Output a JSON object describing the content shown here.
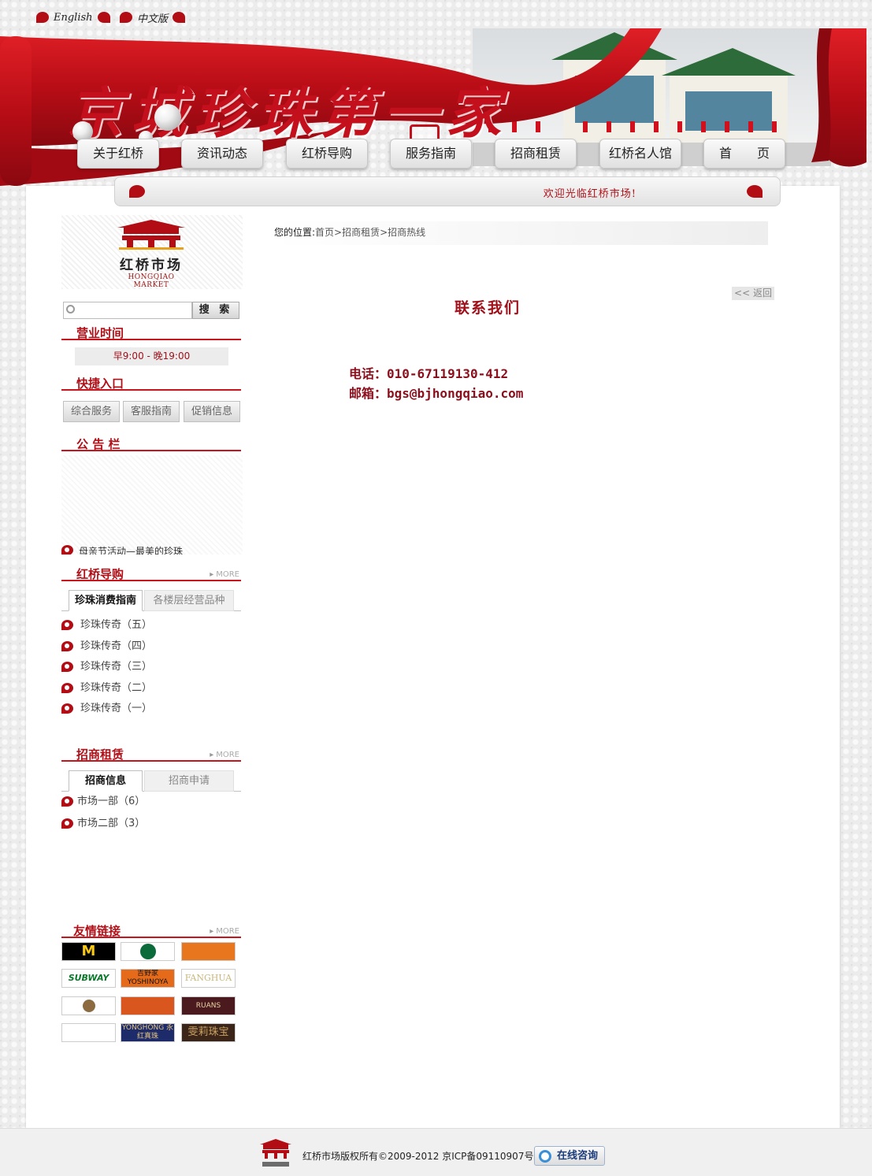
{
  "header": {
    "lang_en": "English",
    "lang_cn": "中文版",
    "calligraphy": "京城珍珠第一家",
    "nav": [
      "关于红桥",
      "资讯动态",
      "红桥导购",
      "服务指南",
      "招商租赁",
      "红桥名人馆",
      "首　　页"
    ],
    "welcome": "欢迎光临红桥市场!"
  },
  "logo": {
    "cn": "红桥市场",
    "en": "HONGQIAO MARKET"
  },
  "search": {
    "placeholder": "",
    "button": "搜 索"
  },
  "hours": {
    "title": "营业时间",
    "value": "早9:00 - 晚19:00"
  },
  "quick": {
    "title": "快捷入口",
    "items": [
      "综合服务",
      "客服指南",
      "促销信息"
    ]
  },
  "notice": {
    "title": "公 告 栏",
    "item": "母亲节活动—最美的珍珠"
  },
  "guide": {
    "title": "红桥导购",
    "more": "MORE",
    "tabs": [
      "珍珠消费指南",
      "各楼层经营品种"
    ],
    "items": [
      "珍珠传奇（五）",
      "珍珠传奇（四）",
      "珍珠传奇（三）",
      "珍珠传奇（二）",
      "珍珠传奇（一）"
    ]
  },
  "lease": {
    "title": "招商租赁",
    "more": "MORE",
    "tabs": [
      "招商信息",
      "招商申请"
    ],
    "items": [
      "市场一部（6）",
      "市场二部（3）"
    ]
  },
  "links": {
    "title": "友情链接",
    "more": "MORE",
    "brands": [
      "M",
      "",
      "",
      "SUBWAY",
      "吉野家 YOSHINOYA",
      "FANGHUA",
      "",
      "",
      "RUANS",
      "",
      "YONGHONG 永红真珠",
      "雯莉珠宝"
    ]
  },
  "breadcrumb": {
    "label": "您的位置:",
    "path": "首页>招商租赁>招商热线"
  },
  "back": "<< 返回",
  "content": {
    "title": "联系我们",
    "phone": "电话：010-67119130-412",
    "email": "邮箱：bgs@bjhongqiao.com"
  },
  "footer": {
    "copyright": "红桥市场版权所有©2009-2012 京ICP备09110907号",
    "chat": "在线咨询"
  },
  "colors": {
    "brand_red": "#c3101c",
    "dark_red": "#8b0f1c",
    "frame_bg": "#ffffff",
    "page_bg": "#ececec"
  }
}
